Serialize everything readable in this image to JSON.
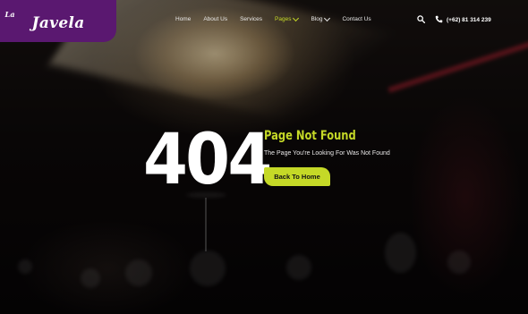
{
  "brand": {
    "logo_small": "La",
    "logo_main": "Javela"
  },
  "nav": {
    "items": [
      {
        "label": "Home"
      },
      {
        "label": "About Us"
      },
      {
        "label": "Services"
      },
      {
        "label": "Pages",
        "has_dropdown": true,
        "active": true
      },
      {
        "label": "Blog",
        "has_dropdown": true
      },
      {
        "label": "Contact Us"
      }
    ]
  },
  "header": {
    "phone": "(+62) 81 314 239",
    "search_icon": "search-icon",
    "phone_icon": "phone-icon"
  },
  "error": {
    "code": "404",
    "title": "Page Not Found",
    "subtitle": "The Page You're Looking For Was Not Found",
    "button_label": "Back To Home"
  },
  "colors": {
    "accent": "#c5d927",
    "brand": "#5a1870",
    "text": "#ffffff"
  }
}
